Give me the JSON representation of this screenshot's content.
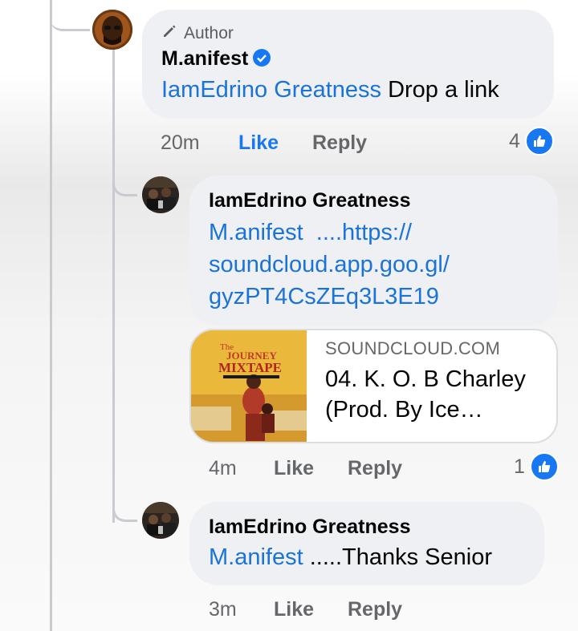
{
  "colors": {
    "link": "#1a73d8",
    "accent": "#1877f2",
    "bubble": "#eff0f3",
    "meta": "#65676b"
  },
  "comment_main": {
    "author_tag": "Author",
    "author_icon": "pencil-icon",
    "name": "M.anifest",
    "mention": "IamEdrino Greatness",
    "text": "Drop a link",
    "time": "20m",
    "like": "Like",
    "reply": "Reply",
    "reaction_count": "4"
  },
  "reply_1": {
    "name": "IamEdrino Greatness",
    "mention": "M.anifest",
    "link_line1": "....https://",
    "link_line2": "soundcloud.app.goo.gl/",
    "link_line3": "gyzPT4CsZEq3L3E19",
    "card": {
      "domain": "SOUNDCLOUD.COM",
      "title": "04. K. O. B Charley (Prod. By Ice…",
      "thumb_title_1": "The",
      "thumb_title_2": "JOURNEY",
      "thumb_title_3": "MIXTAPE"
    },
    "time": "4m",
    "like": "Like",
    "reply": "Reply",
    "reaction_count": "1"
  },
  "reply_2": {
    "name": "IamEdrino Greatness",
    "mention": "M.anifest",
    "text": ".....Thanks Senior",
    "time": "3m",
    "like": "Like",
    "reply": "Reply"
  }
}
